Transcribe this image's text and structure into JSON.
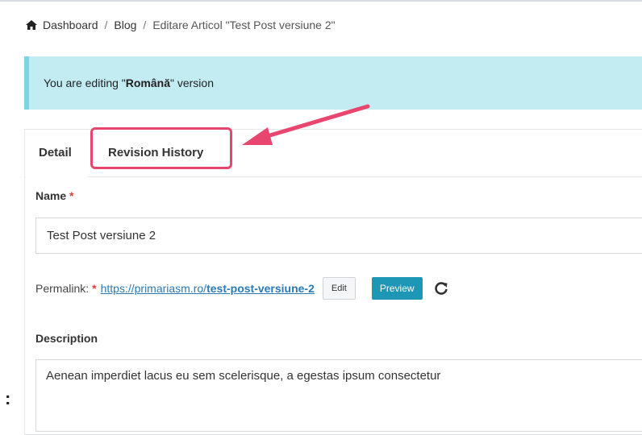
{
  "breadcrumb": {
    "home_icon": "home-icon",
    "items": [
      "Dashboard",
      "Blog",
      "Editare Articol \"Test Post versiune 2\""
    ],
    "separator": "/"
  },
  "alert": {
    "prefix": "You are editing \"",
    "language": "Română",
    "suffix": "\" version"
  },
  "tabs": [
    {
      "label": "Detail",
      "active": true
    },
    {
      "label": "Revision History",
      "active": false
    }
  ],
  "annotation": {
    "highlight_color": "#e8466f"
  },
  "form": {
    "name_label": "Name",
    "required_mark": "*",
    "name_value": "Test Post versiune 2",
    "permalink_label": "Permalink:",
    "permalink_base": "https://primariasm.ro/",
    "permalink_slug": "test-post-versiune-2",
    "edit_button": "Edit",
    "preview_button": "Preview",
    "refresh_icon": "refresh-icon",
    "description_label": "Description",
    "description_value": "Aenean imperdiet lacus eu sem scelerisque, a egestas ipsum consectetur"
  },
  "colors": {
    "alert_bg": "#c3ebf2",
    "preview_bg": "#1e96b5",
    "link": "#2a7ab8"
  },
  "stray_text": ":"
}
